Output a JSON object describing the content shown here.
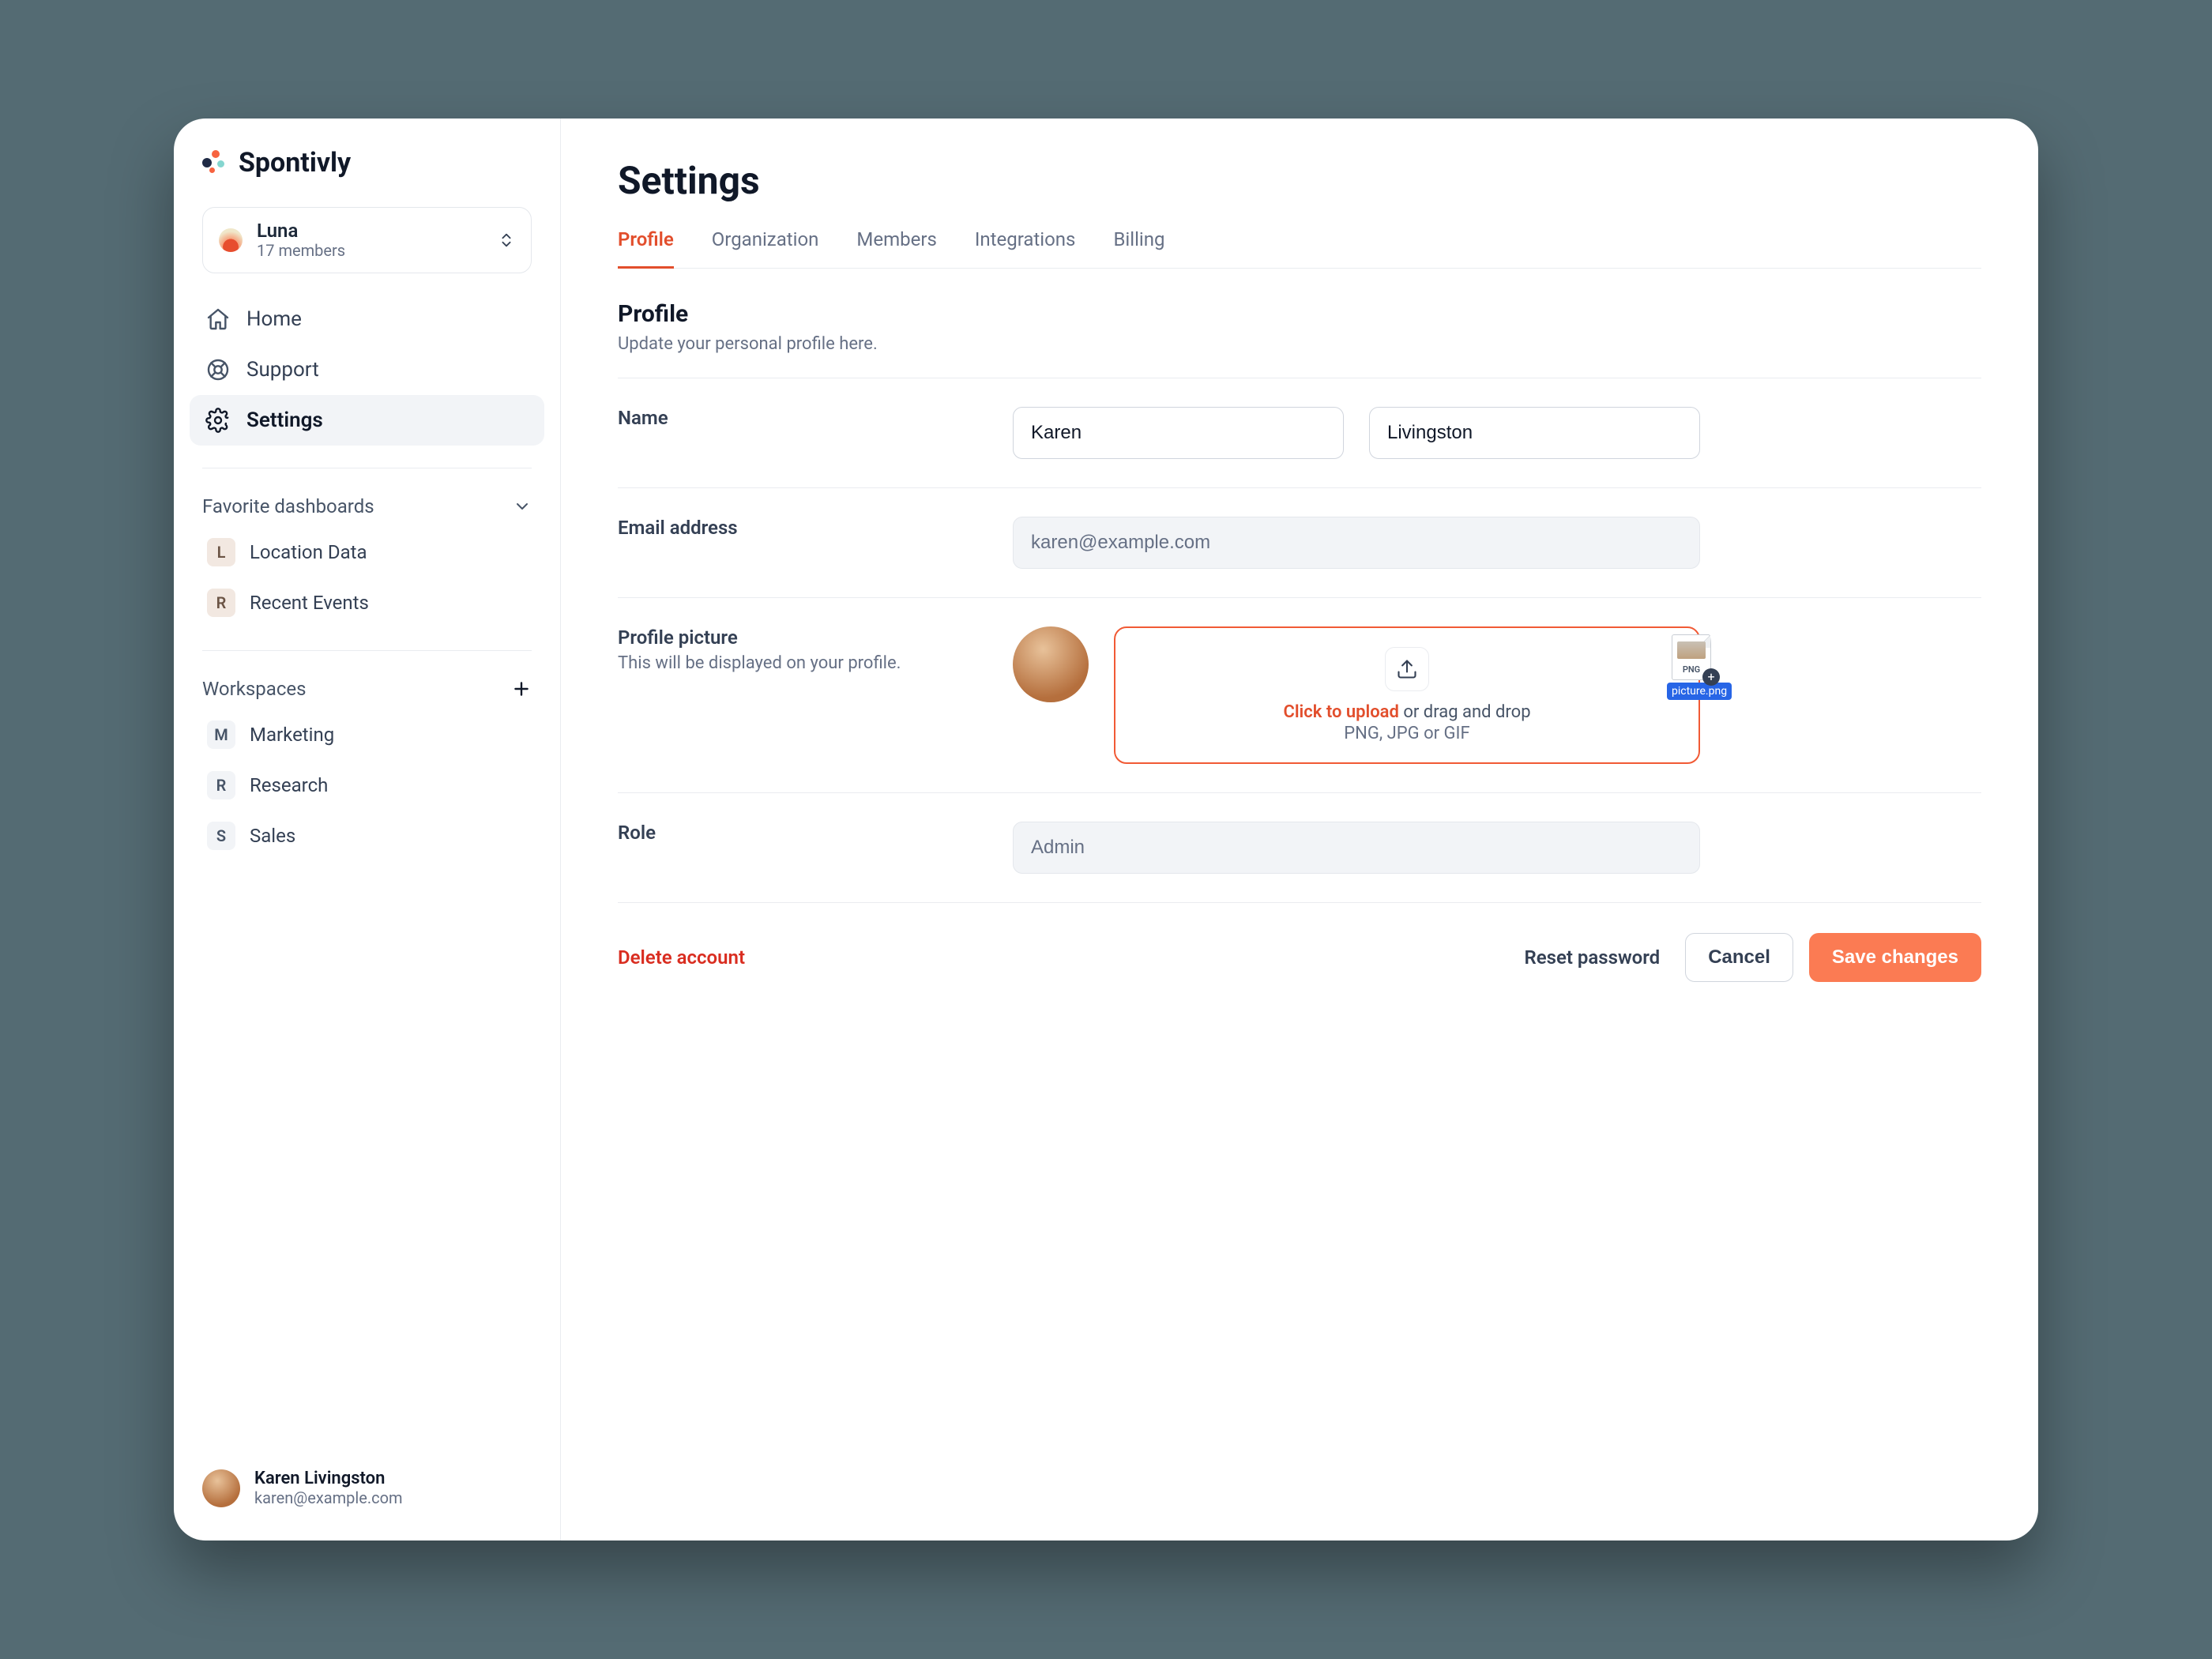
{
  "brand": {
    "name": "Spontivly"
  },
  "org": {
    "name": "Luna",
    "members": "17 members"
  },
  "nav": {
    "home": "Home",
    "support": "Support",
    "settings": "Settings"
  },
  "favorites": {
    "header": "Favorite dashboards",
    "items": [
      {
        "badge": "L",
        "label": "Location Data"
      },
      {
        "badge": "R",
        "label": "Recent Events"
      }
    ]
  },
  "workspaces": {
    "header": "Workspaces",
    "items": [
      {
        "badge": "M",
        "label": "Marketing"
      },
      {
        "badge": "R",
        "label": "Research"
      },
      {
        "badge": "S",
        "label": "Sales"
      }
    ]
  },
  "user": {
    "name": "Karen Livingston",
    "email": "karen@example.com"
  },
  "page": {
    "title": "Settings",
    "tabs": [
      "Profile",
      "Organization",
      "Members",
      "Integrations",
      "Billing"
    ],
    "activeTab": 0,
    "section": {
      "title": "Profile",
      "subtitle": "Update your personal profile here."
    },
    "name": {
      "label": "Name",
      "first": "Karen",
      "last": "Livingston"
    },
    "email": {
      "label": "Email address",
      "value": "karen@example.com"
    },
    "picture": {
      "label": "Profile picture",
      "help": "This will be displayed on your profile.",
      "click": "Click to upload",
      "drag": " or drag and drop",
      "types": "PNG, JPG or GIF",
      "file_thumb_label": "PNG",
      "file_tag": "picture.png"
    },
    "role": {
      "label": "Role",
      "value": "Admin"
    },
    "actions": {
      "delete": "Delete account",
      "reset": "Reset password",
      "cancel": "Cancel",
      "save": "Save changes"
    }
  }
}
